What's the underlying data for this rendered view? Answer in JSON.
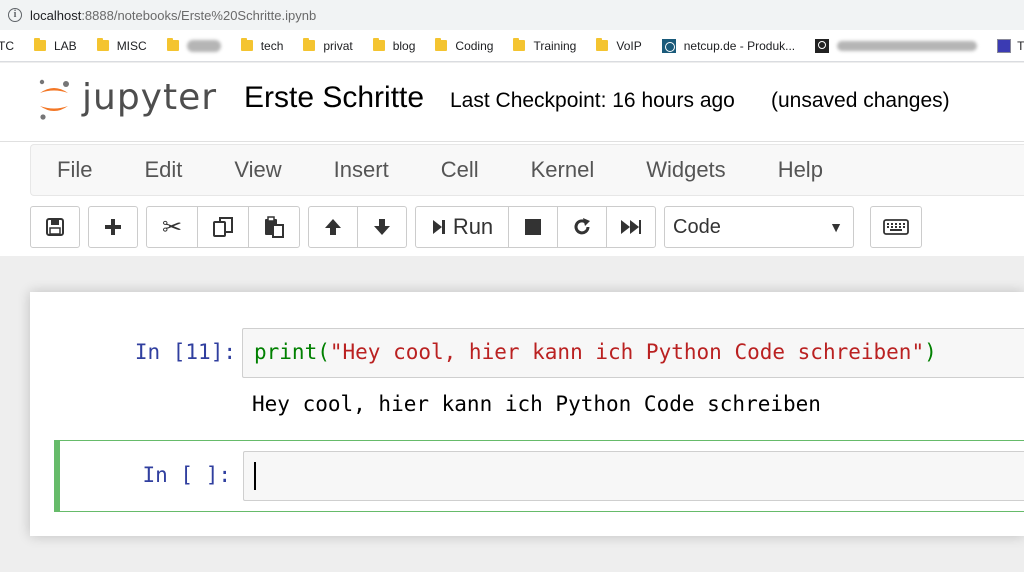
{
  "browser": {
    "url_host": "localhost",
    "url_rest": ":8888/notebooks/Erste%20Schritte.ipynb",
    "bookmarks": [
      {
        "label": "TC",
        "type": "folder"
      },
      {
        "label": "LAB",
        "type": "folder"
      },
      {
        "label": "MISC",
        "type": "folder"
      },
      {
        "label": "",
        "type": "blurred"
      },
      {
        "label": "tech",
        "type": "folder"
      },
      {
        "label": "privat",
        "type": "folder"
      },
      {
        "label": "blog",
        "type": "folder"
      },
      {
        "label": "Coding",
        "type": "folder"
      },
      {
        "label": "Training",
        "type": "folder"
      },
      {
        "label": "VoIP",
        "type": "folder"
      },
      {
        "label": "netcup.de - Produk...",
        "type": "netcup"
      },
      {
        "label": "",
        "type": "search-blurred"
      },
      {
        "label": "T",
        "type": "generic"
      }
    ]
  },
  "header": {
    "logo_text": "jupyter",
    "notebook_title": "Erste Schritte",
    "checkpoint": "Last Checkpoint: 16 hours ago",
    "status": "(unsaved changes)"
  },
  "menubar": {
    "items": [
      "File",
      "Edit",
      "View",
      "Insert",
      "Cell",
      "Kernel",
      "Widgets",
      "Help"
    ]
  },
  "toolbar": {
    "run_label": "Run",
    "cell_type": "Code",
    "icons": [
      "save-icon",
      "plus-icon",
      "cut-icon",
      "copy-icon",
      "paste-icon",
      "arrow-up-icon",
      "arrow-down-icon",
      "step-forward-icon",
      "stop-icon",
      "restart-icon",
      "fast-forward-icon",
      "keyboard-icon"
    ]
  },
  "cells": [
    {
      "prompt": "In [11]:",
      "code_func": "print(",
      "code_string": "\"Hey cool, hier kann ich Python Code schreiben\"",
      "code_close": ")",
      "output": "Hey cool, hier kann ich Python Code schreiben"
    },
    {
      "prompt": "In [ ]:",
      "code": ""
    }
  ],
  "colors": {
    "prompt": "#303f9f",
    "active_cell": "#66bb6a",
    "code_builtin": "#008000",
    "code_string": "#ba2121"
  }
}
